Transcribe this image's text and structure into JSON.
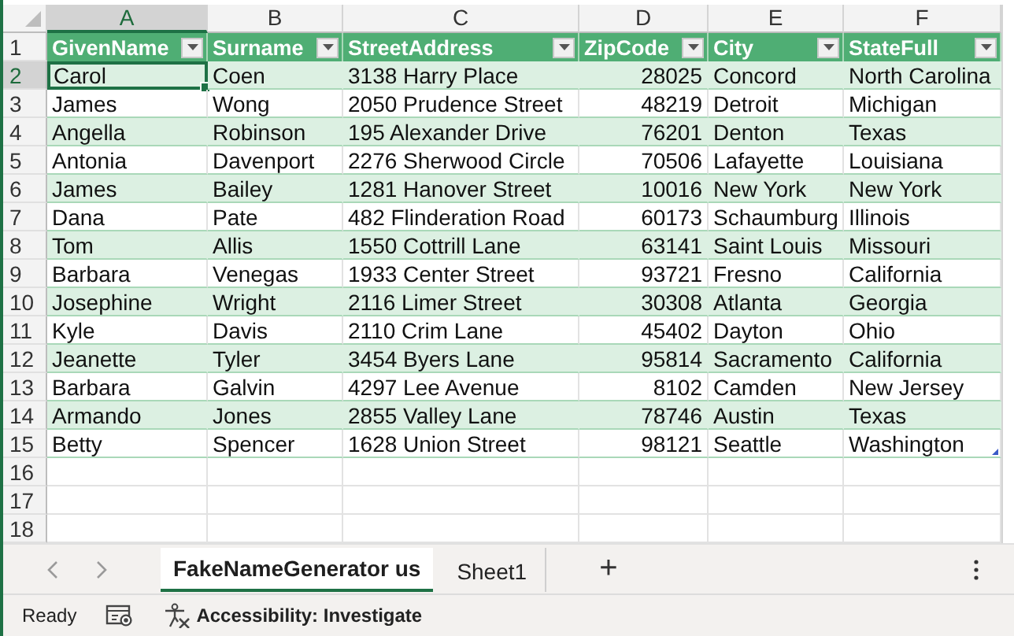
{
  "column_letters": [
    {
      "label": "A",
      "selected": true
    },
    {
      "label": "B",
      "selected": false
    },
    {
      "label": "C",
      "selected": false
    },
    {
      "label": "D",
      "selected": false
    },
    {
      "label": "E",
      "selected": false
    },
    {
      "label": "F",
      "selected": false
    }
  ],
  "table": {
    "header_row_number": "1",
    "columns": [
      {
        "label": "GivenName",
        "kind": "text"
      },
      {
        "label": "Surname",
        "kind": "text"
      },
      {
        "label": "StreetAddress",
        "kind": "text"
      },
      {
        "label": "ZipCode",
        "kind": "number"
      },
      {
        "label": "City",
        "kind": "text"
      },
      {
        "label": "StateFull",
        "kind": "text"
      }
    ],
    "rows": [
      {
        "number": "2",
        "selected": true,
        "cells": [
          "Carol",
          "Coen",
          "3138 Harry Place",
          "28025",
          "Concord",
          "North Carolina"
        ]
      },
      {
        "number": "3",
        "selected": false,
        "cells": [
          "James",
          "Wong",
          "2050 Prudence Street",
          "48219",
          "Detroit",
          "Michigan"
        ]
      },
      {
        "number": "4",
        "selected": false,
        "cells": [
          "Angella",
          "Robinson",
          "195 Alexander Drive",
          "76201",
          "Denton",
          "Texas"
        ]
      },
      {
        "number": "5",
        "selected": false,
        "cells": [
          "Antonia",
          "Davenport",
          "2276 Sherwood Circle",
          "70506",
          "Lafayette",
          "Louisiana"
        ]
      },
      {
        "number": "6",
        "selected": false,
        "cells": [
          "James",
          "Bailey",
          "1281 Hanover Street",
          "10016",
          "New York",
          "New York"
        ]
      },
      {
        "number": "7",
        "selected": false,
        "cells": [
          "Dana",
          "Pate",
          "482 Flinderation Road",
          "60173",
          "Schaumburg",
          "Illinois"
        ]
      },
      {
        "number": "8",
        "selected": false,
        "cells": [
          "Tom",
          "Allis",
          "1550 Cottrill Lane",
          "63141",
          "Saint Louis",
          "Missouri"
        ]
      },
      {
        "number": "9",
        "selected": false,
        "cells": [
          "Barbara",
          "Venegas",
          "1933 Center Street",
          "93721",
          "Fresno",
          "California"
        ]
      },
      {
        "number": "10",
        "selected": false,
        "cells": [
          "Josephine",
          "Wright",
          "2116 Limer Street",
          "30308",
          "Atlanta",
          "Georgia"
        ]
      },
      {
        "number": "11",
        "selected": false,
        "cells": [
          "Kyle",
          "Davis",
          "2110 Crim Lane",
          "45402",
          "Dayton",
          "Ohio"
        ]
      },
      {
        "number": "12",
        "selected": false,
        "cells": [
          "Jeanette",
          "Tyler",
          "3454 Byers Lane",
          "95814",
          "Sacramento",
          "California"
        ]
      },
      {
        "number": "13",
        "selected": false,
        "cells": [
          "Barbara",
          "Galvin",
          "4297 Lee Avenue",
          "8102",
          "Camden",
          "New Jersey"
        ]
      },
      {
        "number": "14",
        "selected": false,
        "cells": [
          "Armando",
          "Jones",
          "2855 Valley Lane",
          "78746",
          "Austin",
          "Texas"
        ]
      },
      {
        "number": "15",
        "selected": false,
        "cells": [
          "Betty",
          "Spencer",
          "1628 Union Street",
          "98121",
          "Seattle",
          "Washington"
        ]
      }
    ]
  },
  "empty_rows": [
    "16",
    "17",
    "18"
  ],
  "sheet_tabs": [
    {
      "label": "FakeNameGenerator us",
      "selected": true
    },
    {
      "label": "Sheet1",
      "selected": false
    }
  ],
  "add_sheet": "+",
  "status_bar": {
    "mode": "Ready",
    "accessibility": "Accessibility: Investigate"
  }
}
